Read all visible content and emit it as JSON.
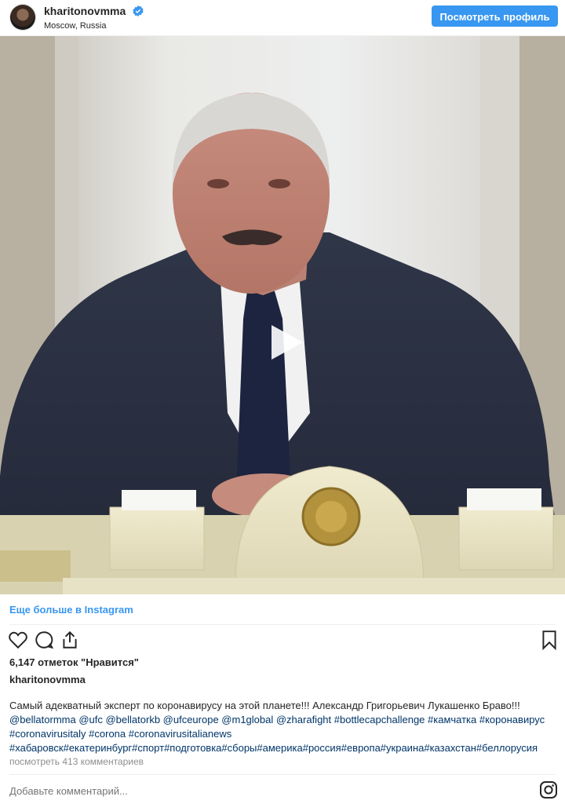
{
  "header": {
    "username": "kharitonovmma",
    "location": "Moscow, Russia",
    "view_profile_label": "Посмотреть профиль"
  },
  "media": {
    "type": "video"
  },
  "links": {
    "more_on_instagram": "Еще больше в Instagram"
  },
  "actions": {
    "icons": [
      "heart-icon",
      "comment-icon",
      "share-icon",
      "bookmark-icon"
    ]
  },
  "post": {
    "likes": "6,147 отметок \"Нравится\"",
    "caption_user": "kharitonovmma",
    "caption_line1": "Самый адекватный эксперт по коронавирусу на этой планете!!! Александр Григорьевич Лукашенко Браво!!!",
    "caption_line2": "@bellatormma @ufc @bellatorkb @ufceurope @m1global @zharafight #bottlecapchallenge #камчатка #коронавирус",
    "caption_line3": "#coronavirusitaly #corona #coronavirusitalianews",
    "caption_line4": "#хабаровск#екатеринбург#спорт#подготовка#сборы#америка#россия#европа#украина#казахстан#беллорусия",
    "view_comments": "посмотреть 413 комментариев",
    "add_comment_placeholder": "Добавьте комментарий..."
  },
  "colors": {
    "accent": "#3897f0",
    "hashtag": "#003569",
    "muted": "#8e8e8e"
  }
}
